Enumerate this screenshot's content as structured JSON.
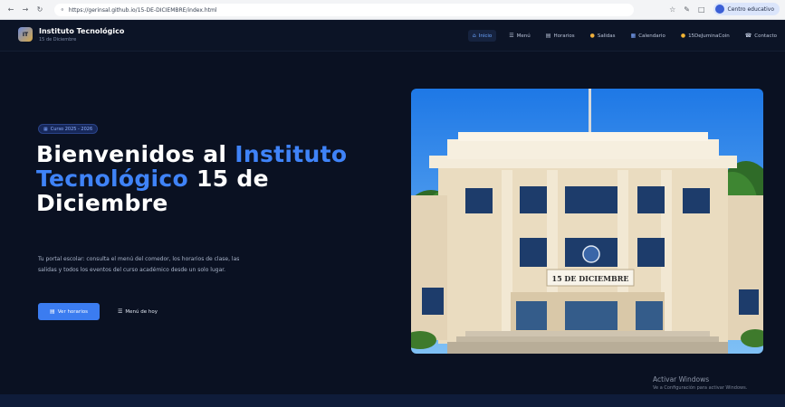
{
  "browser": {
    "url": "https://gerinsal.github.io/15-DE-DICIEMBRE/index.html",
    "profile_label": "Centro educativo",
    "icons": [
      "back-icon",
      "forward-icon",
      "reload-icon",
      "lock-icon",
      "star-icon",
      "extensions-icon",
      "split-icon"
    ]
  },
  "site": {
    "logo_text": "IT",
    "brand_title": "Instituto Tecnológico",
    "brand_subtitle": "15 de Diciembre",
    "nav": [
      {
        "label": "Inicio",
        "icon": "home-icon",
        "active": true
      },
      {
        "label": "Menú",
        "icon": "menu-icon",
        "active": false
      },
      {
        "label": "Horarios",
        "icon": "schedule-icon",
        "active": false
      },
      {
        "label": "Salidas",
        "icon": "trips-icon",
        "active": false
      },
      {
        "label": "Calendario",
        "icon": "calendar-icon",
        "active": false
      },
      {
        "label": "15DeJuminaCoin",
        "icon": "coin-icon",
        "active": false
      },
      {
        "label": "Contacto",
        "icon": "contact-icon",
        "active": false
      }
    ]
  },
  "hero": {
    "badge": "Curso 2025 - 2026",
    "title_part1": "Bienvenidos al ",
    "title_highlight": "Instituto Tecnológico",
    "title_part2": " 15 de Diciembre",
    "description": "Tu portal escolar: consulta el menú del comedor, los horarios de clase, las salidas y todos los eventos del curso académico desde un solo lugar.",
    "btn_primary": "Ver horarios",
    "btn_secondary": "Menú de hoy",
    "image_sign": "15 DE DICIEMBRE"
  },
  "watermark": {
    "title": "Activar Windows",
    "subtitle": "Ve a Configuración para activar Windows."
  },
  "colors": {
    "background": "#0a1122",
    "accent": "#3b7cf0",
    "highlight": "#3f83f8"
  }
}
